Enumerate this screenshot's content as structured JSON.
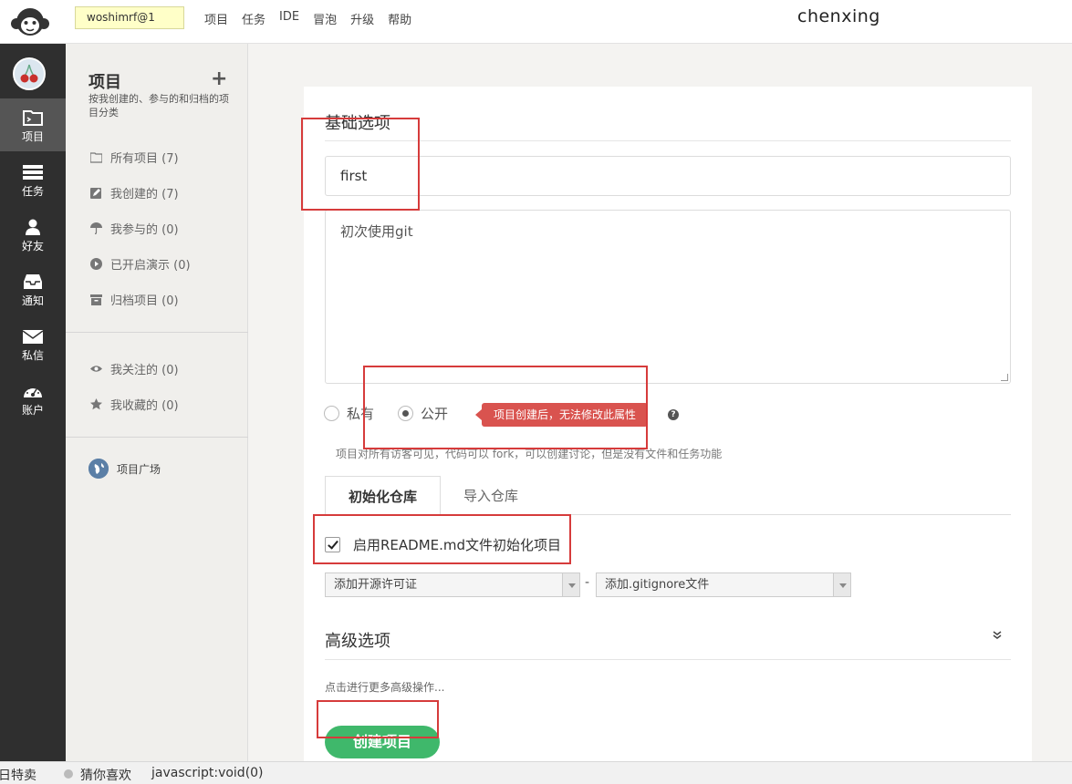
{
  "topbar": {
    "user_chip": "woshimrf@1",
    "nav": [
      "项目",
      "任务",
      "IDE",
      "冒泡",
      "升级",
      "帮助"
    ],
    "brand": "chenxing"
  },
  "dark_sidebar": {
    "items": [
      {
        "label": "项目",
        "icon": "folder-icon",
        "active": true
      },
      {
        "label": "任务",
        "icon": "task-list-icon"
      },
      {
        "label": "好友",
        "icon": "user-icon"
      },
      {
        "label": "通知",
        "icon": "inbox-icon"
      },
      {
        "label": "私信",
        "icon": "envelope-icon"
      },
      {
        "label": "账户",
        "icon": "dashboard-icon"
      }
    ]
  },
  "project_sidebar": {
    "title": "项目",
    "plus": "+",
    "desc": "按我创建的、参与的和归档的项目分类",
    "items": [
      {
        "label": "所有项目 (7)",
        "icon": "folder-icon"
      },
      {
        "label": "我创建的 (7)",
        "icon": "edit-icon"
      },
      {
        "label": "我参与的 (0)",
        "icon": "umbrella-icon"
      },
      {
        "label": "已开启演示 (0)",
        "icon": "play-icon"
      },
      {
        "label": "归档项目 (0)",
        "icon": "archive-icon"
      }
    ],
    "items2": [
      {
        "label": "我关注的 (0)",
        "icon": "eye-icon"
      },
      {
        "label": "我收藏的 (0)",
        "icon": "star-icon"
      }
    ],
    "square": "项目广场"
  },
  "form": {
    "basic_title": "基础选项",
    "name_value": "first",
    "desc_value": "初次使用git",
    "private_label": "私有",
    "public_label": "公开",
    "tooltip": "项目创建后，无法修改此属性",
    "help": "?",
    "public_note": "项目对所有访客可见，代码可以 fork，可以创建讨论，但是没有文件和任务功能",
    "tabs": [
      "初始化仓库",
      "导入仓库"
    ],
    "readme_label": "启用README.md文件初始化项目",
    "readme_checked": true,
    "license_select": "添加开源许可证",
    "dash": "-",
    "gitignore_select": "添加.gitignore文件",
    "advanced_title": "高级选项",
    "advanced_note": "点击进行更多高级操作...",
    "create_button": "创建项目"
  },
  "bottombar": {
    "left": "日特卖",
    "middle": "猜你喜欢",
    "status": "javascript:void(0)"
  },
  "colors": {
    "annotation": "#d63b3b",
    "create": "#3fb86b",
    "tooltip": "#d9534f",
    "user_chip": "#ffffc8"
  }
}
